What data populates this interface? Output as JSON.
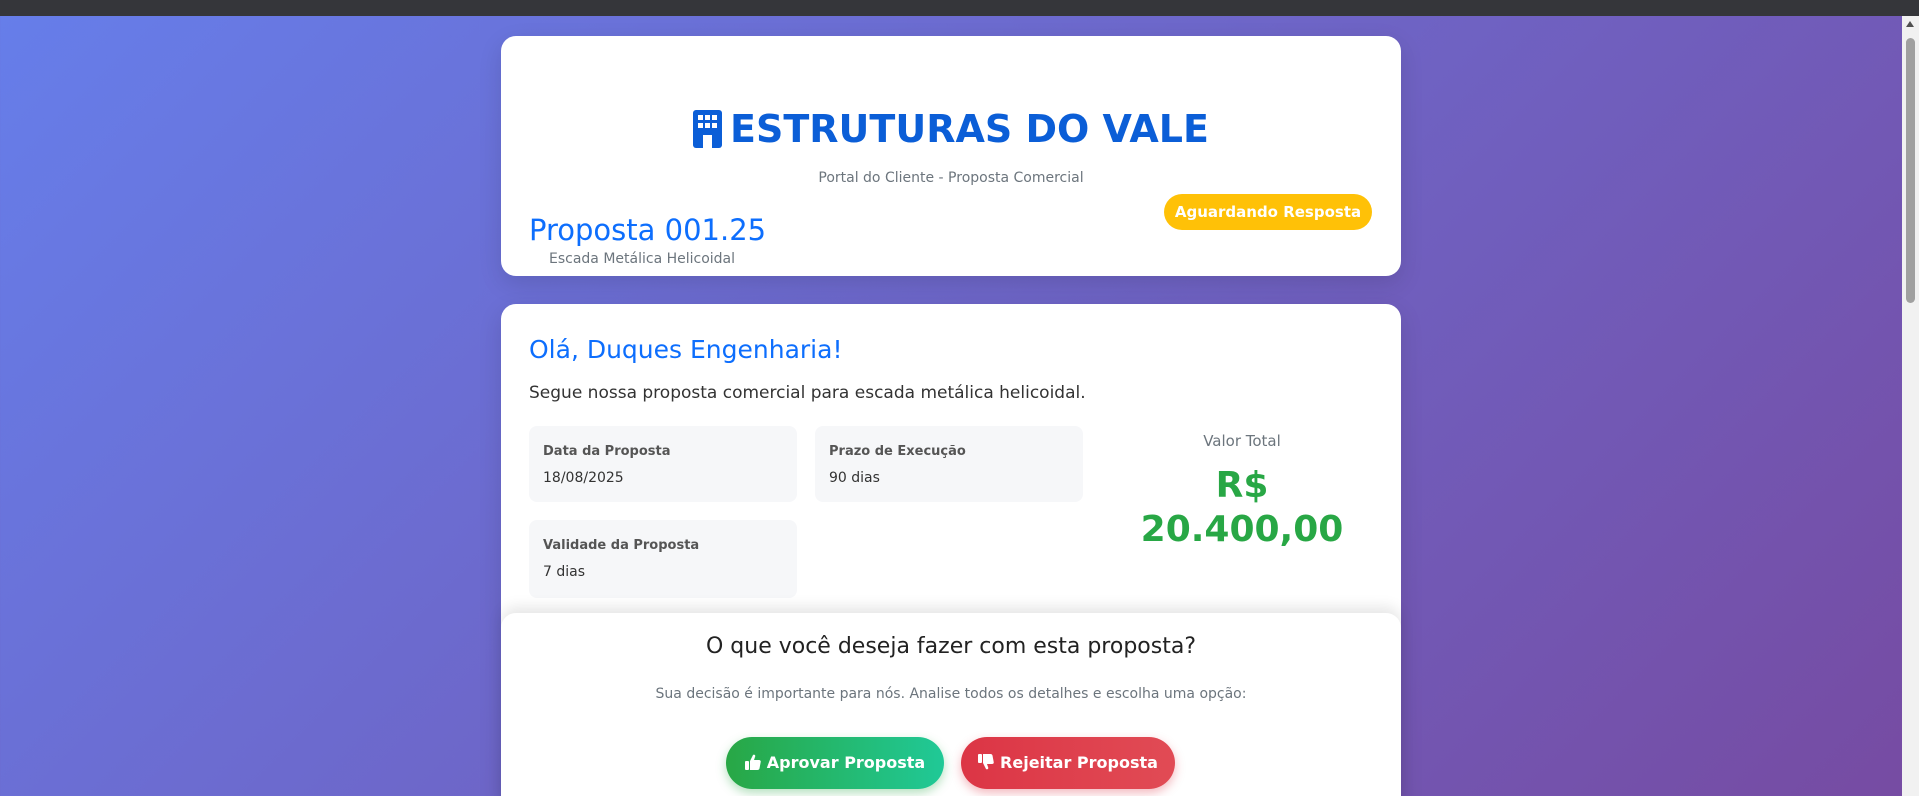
{
  "header": {
    "company_name": "ESTRUTURAS DO VALE",
    "subtitle": "Portal do Cliente - Proposta Comercial",
    "proposal_number": "Proposta 001.25",
    "proposal_description": "Escada Metálica Helicoidal",
    "status": "Aguardando Resposta"
  },
  "main": {
    "greeting": "Olá, Duques Engenharia!",
    "intro": "Segue nossa proposta comercial para escada metálica helicoidal.",
    "info": [
      {
        "label": "Data da Proposta",
        "value": "18/08/2025"
      },
      {
        "label": "Prazo de Execução",
        "value": "90 dias"
      },
      {
        "label": "Validade da Proposta",
        "value": "7 dias"
      }
    ],
    "total_label": "Valor Total",
    "total_value": "R$ 20.400,00"
  },
  "actions": {
    "title": "O que você deseja fazer com esta proposta?",
    "description": "Sua decisão é importante para nós. Analise todos os detalhes e escolha uma opção:",
    "approve_label": "Aprovar Proposta",
    "reject_label": "Rejeitar Proposta"
  },
  "icons": {
    "company": "building-icon",
    "approve": "thumbs-up-icon",
    "reject": "thumbs-down-icon"
  },
  "colors": {
    "brand_blue": "#0b5ed7",
    "status_warning": "#ffc107",
    "success": "#28a745",
    "danger": "#dc3545",
    "background_start": "#667eea",
    "background_end": "#764ba2"
  }
}
